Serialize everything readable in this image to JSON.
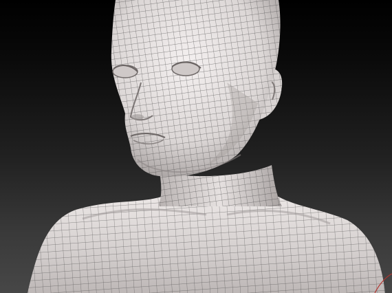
{
  "scene": {
    "subject": "wireframe-female-bust",
    "render_style": "clay-with-quad-topology",
    "colors": {
      "background_top": "#000000",
      "background_bottom": "#474747",
      "clay_light": "#f2eeee",
      "clay_mid": "#cfcac9",
      "clay_shadow": "#8c8686",
      "wire": "#3a3a3a",
      "accent_gizmo": "#b3342f"
    }
  }
}
